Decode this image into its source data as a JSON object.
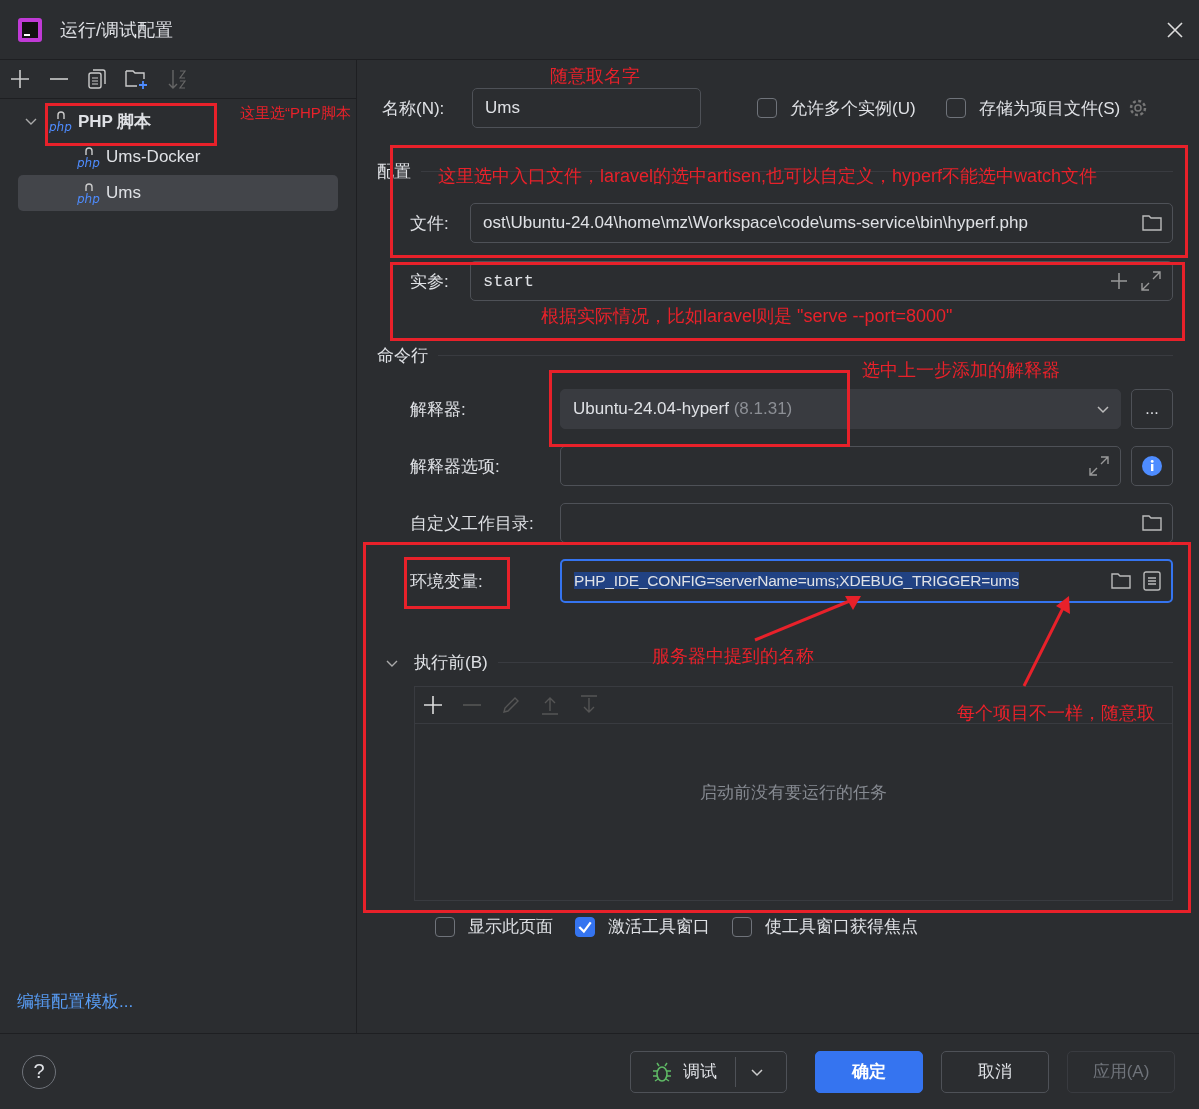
{
  "window": {
    "title": "运行/调试配置"
  },
  "tree": [
    {
      "label": "PHP 脚本",
      "icon": "php",
      "expanded": true,
      "selected": false,
      "children": [
        {
          "label": "Ums-Docker",
          "icon": "php",
          "selected": false
        },
        {
          "label": "Ums",
          "icon": "php",
          "selected": true
        }
      ]
    }
  ],
  "edit_templates_link": "编辑配置模板...",
  "name_field": {
    "label": "名称(N):",
    "value": "Ums"
  },
  "options": [
    {
      "label": "允许多个实例(U)",
      "checked": false
    },
    {
      "label": "存储为项目文件(S)",
      "checked": false
    }
  ],
  "config_section": "配置",
  "file_field": {
    "label": "文件:",
    "value": "ost\\Ubuntu-24.04\\home\\mz\\Workspace\\code\\ums-service\\bin\\hyperf.php"
  },
  "args_field": {
    "label": "实参:",
    "value": "start"
  },
  "command_section": "命令行",
  "interpreter": {
    "label": "解释器:",
    "value": "Ubuntu-24.04-hyperf",
    "version": "(8.1.31)",
    "more": "..."
  },
  "interpreter_options": {
    "label": "解释器选项:"
  },
  "working_dir": {
    "label": "自定义工作目录:"
  },
  "env_vars": {
    "label": "环境变量:",
    "value": "PHP_IDE_CONFIG=serverName=ums;XDEBUG_TRIGGER=ums",
    "focused": true
  },
  "before_launch": {
    "label": "执行前(B)",
    "expanded": true,
    "empty_text": "启动前没有要运行的任务"
  },
  "launch_options": [
    {
      "label": "显示此页面",
      "checked": false
    },
    {
      "label": "激活工具窗口",
      "checked": true
    },
    {
      "label": "使工具窗口获得焦点",
      "checked": false
    }
  ],
  "help": "?",
  "buttons": [
    {
      "label": "调试",
      "kind": "split"
    },
    {
      "label": "确定",
      "kind": "primary"
    },
    {
      "label": "取消",
      "kind": "normal"
    },
    {
      "label": "应用(A)",
      "kind": "disabled"
    }
  ],
  "annotations": [
    "这里选“PHP脚本",
    "随意取名字",
    "这里选中入口文件，laravel的选中artisen,也可以自定义，hyperf不能选中watch文件",
    "根据实际情况，比如laravel则是 \"serve --port=8000\"",
    "选中上一步添加的解释器",
    "服务器中提到的名称",
    "每个项目不一样，随意取"
  ]
}
